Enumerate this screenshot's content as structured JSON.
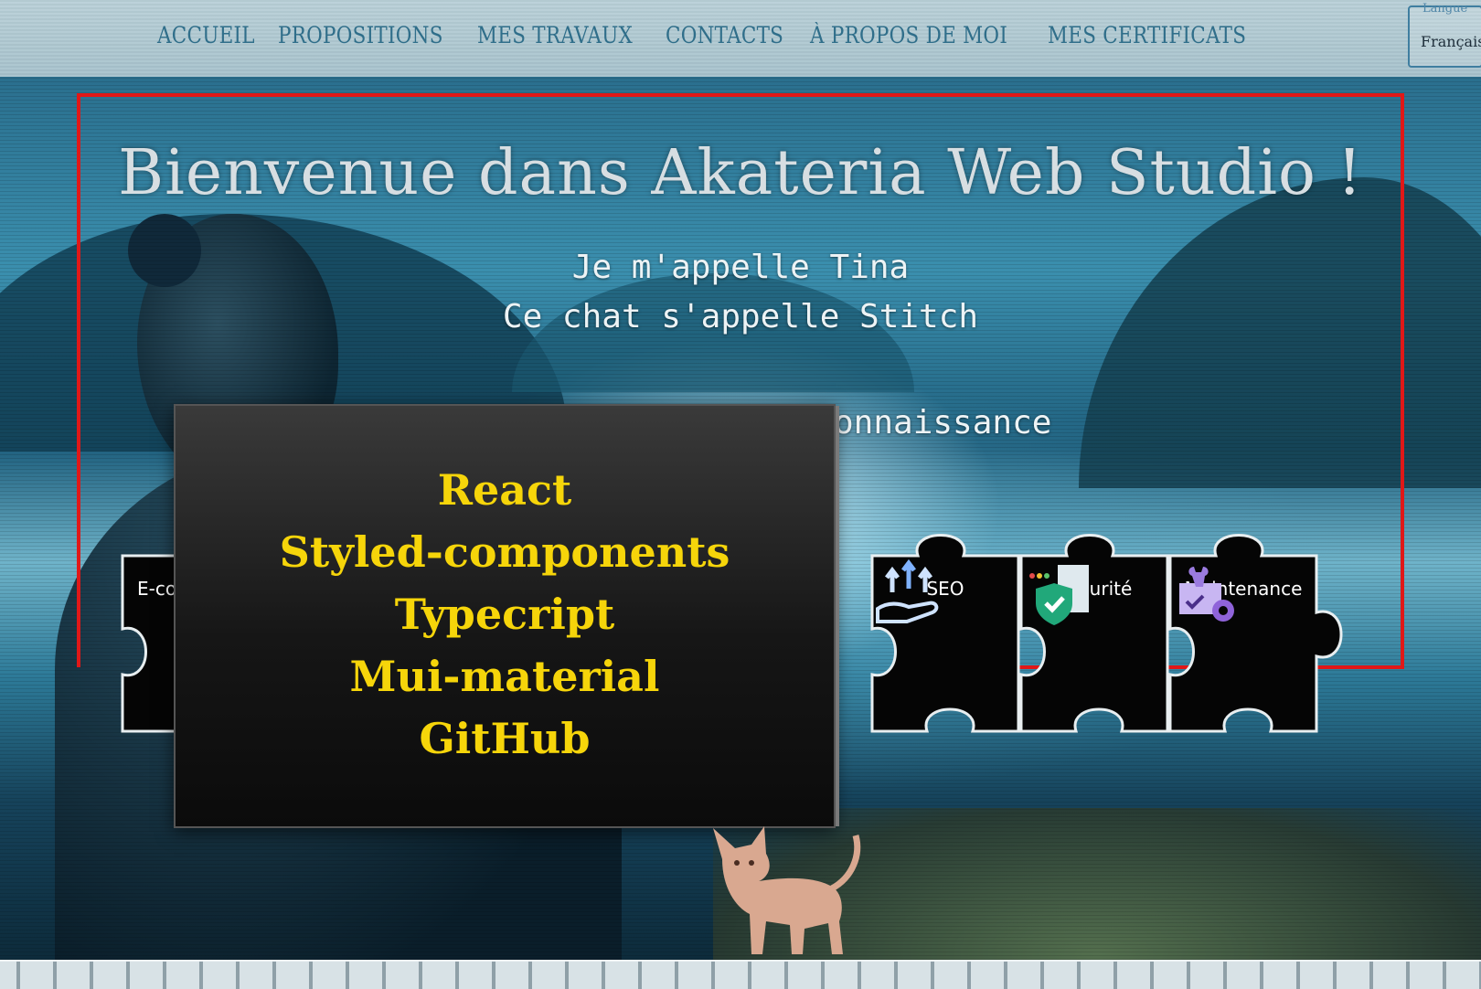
{
  "nav": {
    "items": [
      "ACCUEIL",
      "PROPOSITIONS",
      "MES TRAVAUX",
      "CONTACTS",
      "À PROPOS DE MOI",
      "MES CERTIFICATS"
    ]
  },
  "language": {
    "label": "Langue",
    "value": "Français"
  },
  "hero": {
    "title": "Bienvenue dans Akateria Web Studio !",
    "line1": "Je m'appelle Tina",
    "line2": "Ce chat s'appelle Stitch",
    "partial_line": "onnaissance"
  },
  "puzzles": {
    "left_partial": "E-co",
    "seo": "SEO",
    "securite": "Securité",
    "maintenance": "Maintenance"
  },
  "tech_card": {
    "items": [
      "React",
      "Styled-components",
      "Typecript",
      "Mui-material",
      "GitHub"
    ]
  },
  "colors": {
    "nav_text": "#2f6e8a",
    "tech_text": "#f6d50a",
    "frame": "#e01818",
    "puzzle": "#050505"
  }
}
